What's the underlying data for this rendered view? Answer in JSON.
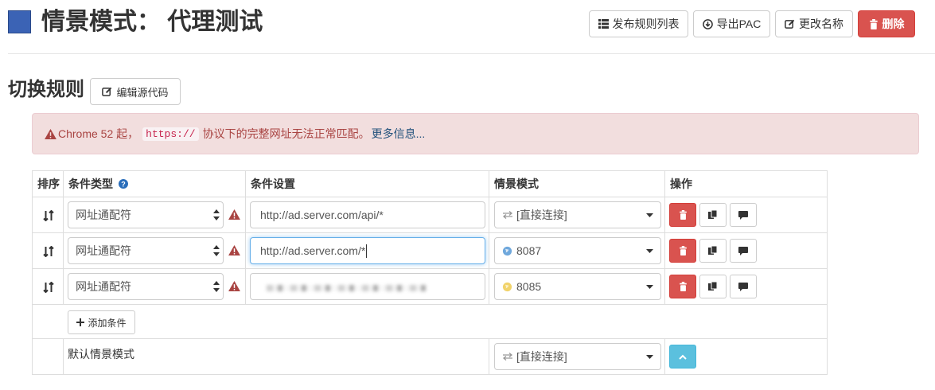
{
  "header": {
    "profile_name": "情景模式： 代理测试",
    "profile_color": "#3b63b5",
    "buttons": {
      "publish": "发布规则列表",
      "export_pac": "导出PAC",
      "rename": "更改名称",
      "delete": "删除"
    }
  },
  "section": {
    "title": "切换规则",
    "edit_source": "编辑源代码"
  },
  "alert": {
    "prefix": "Chrome 52 起，",
    "code": "https://",
    "suffix": "协议下的完整网址无法正常匹配。",
    "link": "更多信息..."
  },
  "table": {
    "columns": {
      "sort": "排序",
      "condition_type": "条件类型",
      "condition": "条件设置",
      "profile": "情景模式",
      "actions": "操作"
    },
    "rules": [
      {
        "type": "网址通配符",
        "condition": "http://ad.server.com/api/*",
        "profile": "[直接连接]",
        "profile_icon": "direct-arrows-icon"
      },
      {
        "type": "网址通配符",
        "condition": "http://ad.server.com/*",
        "profile": "8087",
        "profile_icon": "globe-icon",
        "focused": true
      },
      {
        "type": "网址通配符",
        "condition": "",
        "profile": "8085",
        "profile_icon": "globe-icon",
        "blurred": true
      }
    ],
    "add_condition": "添加条件",
    "default_label": "默认情景模式",
    "default_profile": "[直接连接]"
  },
  "colors": {
    "danger": "#d9534f",
    "info": "#5bc0de",
    "alert_bg": "#f2dede",
    "alert_text": "#a94442",
    "warning_icon": "#a94442",
    "globe_8087": "#6fa8dc",
    "globe_8085": "#f1d36b"
  }
}
